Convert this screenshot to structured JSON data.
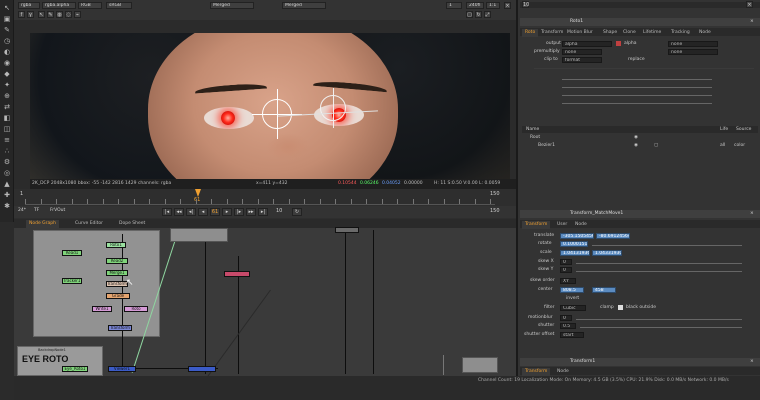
{
  "viewer": {
    "header": {
      "channel": "rgba",
      "layer": "rgba.alpha",
      "colorspace": "RGB",
      "display": "sRGB",
      "merge_a": "Merged",
      "merge_b": "Merged",
      "frame": "1",
      "resolution": "240fi",
      "zoom": "1:1"
    },
    "status_text": "2K_DCP 2048x1080 bbox: -55 -142 2816 1429 channels: rgba",
    "coords": "x=411 y=432",
    "rgba": [
      "0.10544",
      "0.06246",
      "0.04052",
      "0.00000"
    ],
    "hsvl": "H: 11 S:0.50 V:0.00 L: 0.0059",
    "timeline": {
      "start": "1",
      "end": "150",
      "current": "61",
      "marker_in": "1",
      "marker_out": "150"
    },
    "playbar": {
      "fps_label": "24*",
      "tf_label": "TF",
      "range": "FrVOut",
      "step": "10",
      "end_frame": "150"
    }
  },
  "node_graph": {
    "tabs": [
      "Node Graph",
      "Curve Editor",
      "Dope Sheet"
    ],
    "nodes": {
      "read1": "Read1",
      "roto1": "Roto1",
      "read2": "Read2",
      "track": "Tracker1",
      "merge": "Merge1",
      "transform": "Transform",
      "grade": "Grade",
      "write1": "Write1",
      "roto": "Roto",
      "transform2": "Transform",
      "viewer": "Viewer1",
      "eye_node": "Eye_Roto1"
    },
    "backdrop_label": "BackdropNode1",
    "eye_roto_label": "EYE ROTO"
  },
  "statusbar": "Channel Count: 19 Localization Mode: On Memory: 4.5 GB (3.5%) CPU: 21.9% Disk: 0.0 MB/s Network: 0.0 MB/s",
  "properties": {
    "roto": {
      "title": "Roto1",
      "tabs": [
        "Roto",
        "Transform",
        "Motion Blur",
        "Shape",
        "Clone",
        "Lifetime",
        "Tracking",
        "Node"
      ],
      "output_label": "output",
      "output_value": "alpha",
      "output_extra": "none",
      "premultiply_label": "premultiply",
      "premultiply_value": "none",
      "clip_label": "clip to",
      "clip_value": "format",
      "replace_label": "replace",
      "layer_cols": [
        "Name",
        "Life",
        "Source"
      ],
      "layer_root": "Root",
      "layer_item": "Bezier1",
      "layer_life": "all",
      "layer_source": "color"
    },
    "transform": {
      "title": "Transform_MatchMove1",
      "tabs": [
        "Transform",
        "User",
        "Node"
      ],
      "translate_label": "translate",
      "translate_x": "-305.1505456",
      "translate_y": "-80.69124564",
      "rotate_label": "rotate",
      "rotate_value": "0.10001512",
      "scale_label": "scale",
      "scale_x": "1.04131936",
      "scale_y": "1.04331930",
      "skewx_label": "skew X",
      "skewx_value": "0",
      "skewy_label": "skew Y",
      "skewy_value": "0",
      "skeworder_label": "skew order",
      "skeworder_value": "XY",
      "center_label": "center",
      "center_x": "808.5",
      "center_y": "458",
      "invert_label": "invert",
      "filter_label": "filter",
      "filter_value": "Cubic",
      "clamp_label": "clamp",
      "black_outside_label": "black outside",
      "motionblur_label": "motionblur",
      "motionblur_value": "0",
      "shutter_label": "shutter",
      "shutter_value": "0.5",
      "shutter_offset_label": "shutter offset",
      "shutter_offset_value": "start"
    },
    "transform2": {
      "title": "Transform1",
      "tabs": [
        "Transform",
        "Node"
      ]
    }
  }
}
